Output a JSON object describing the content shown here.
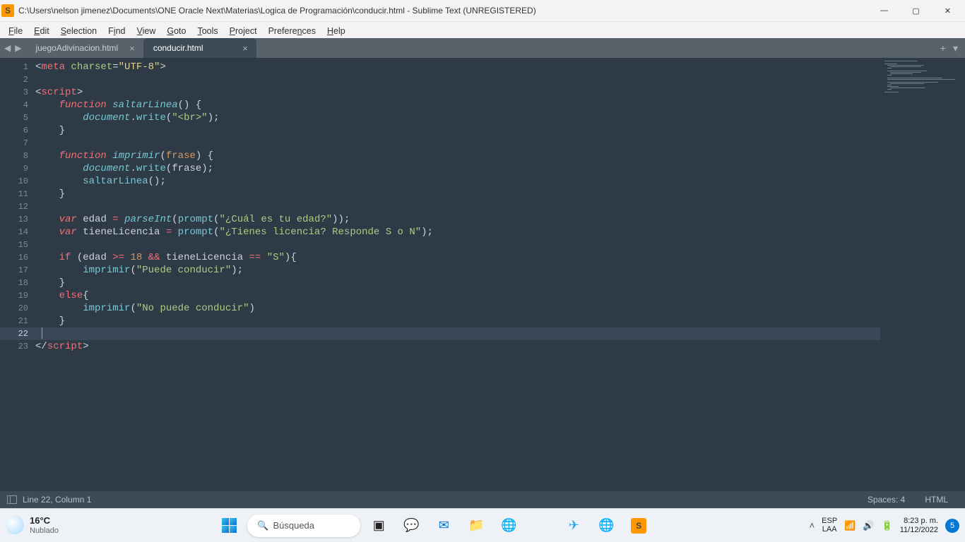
{
  "titlebar": {
    "path": "C:\\Users\\nelson jimenez\\Documents\\ONE Oracle Next\\Materias\\Logica de Programación\\conducir.html - Sublime Text (UNREGISTERED)"
  },
  "menu": [
    "File",
    "Edit",
    "Selection",
    "Find",
    "View",
    "Goto",
    "Tools",
    "Project",
    "Preferences",
    "Help"
  ],
  "tabs": [
    {
      "name": "juegoAdivinacion.html",
      "active": false
    },
    {
      "name": "conducir.html",
      "active": true
    }
  ],
  "lines": 23,
  "active_line": 22,
  "status": {
    "pos": "Line 22, Column 1",
    "spaces": "Spaces: 4",
    "syntax": "HTML"
  },
  "code": {
    "l1_tag": "meta",
    "l1_attr": "charset",
    "l1_eq": "=",
    "l1_val": "\"UTF-8\"",
    "l3_tag": "script",
    "l4_kw": "function",
    "l4_fn": "saltarLinea",
    "l4_p": "() {",
    "l5_obj": "document",
    "l5_dot": ".",
    "l5_call": "write",
    "l5_open": "(",
    "l5_str": "\"<br>\"",
    "l5_close": ");",
    "l6_brace": "}",
    "l8_kw": "function",
    "l8_fn": "imprimir",
    "l8_op": "(",
    "l8_param": "frase",
    "l8_cl": ") {",
    "l9_obj": "document",
    "l9_dot": ".",
    "l9_call": "write",
    "l9_op": "(",
    "l9_arg": "frase",
    "l9_cl": ");",
    "l10_call": "saltarLinea",
    "l10_par": "();",
    "l11_brace": "}",
    "l13_kw": "var",
    "l13_name": "edad",
    "l13_eq": " = ",
    "l13_fn": "parseInt",
    "l13_op": "(",
    "l13_call": "prompt",
    "l13_op2": "(",
    "l13_str": "\"¿Cuál es tu edad?\"",
    "l13_cl": "));",
    "l14_kw": "var",
    "l14_name": "tieneLicencia",
    "l14_eq": " = ",
    "l14_call": "prompt",
    "l14_op": "(",
    "l14_str": "\"¿Tienes licencia? Responde S o N\"",
    "l14_cl": ");",
    "l16_kw": "if",
    "l16_op": " (",
    "l16_v1": "edad",
    "l16_cmp": " >= ",
    "l16_num": "18",
    "l16_and": " && ",
    "l16_v2": "tieneLicencia",
    "l16_eq": " == ",
    "l16_str": "\"S\"",
    "l16_cl": "){",
    "l17_call": "imprimir",
    "l17_op": "(",
    "l17_str": "\"Puede conducir\"",
    "l17_cl": ");",
    "l18_brace": "}",
    "l19_kw": "else",
    "l19_brace": "{",
    "l20_call": "imprimir",
    "l20_op": "(",
    "l20_str": "\"No puede conducir\"",
    "l20_cl": ")",
    "l21_brace": "}",
    "l23_close": "script"
  },
  "taskbar": {
    "weather_temp": "16°C",
    "weather_cond": "Nublado",
    "search": "Búsqueda",
    "lang1": "ESP",
    "lang2": "LAA",
    "time": "8:23 p. m.",
    "date": "11/12/2022",
    "notif": "5"
  }
}
